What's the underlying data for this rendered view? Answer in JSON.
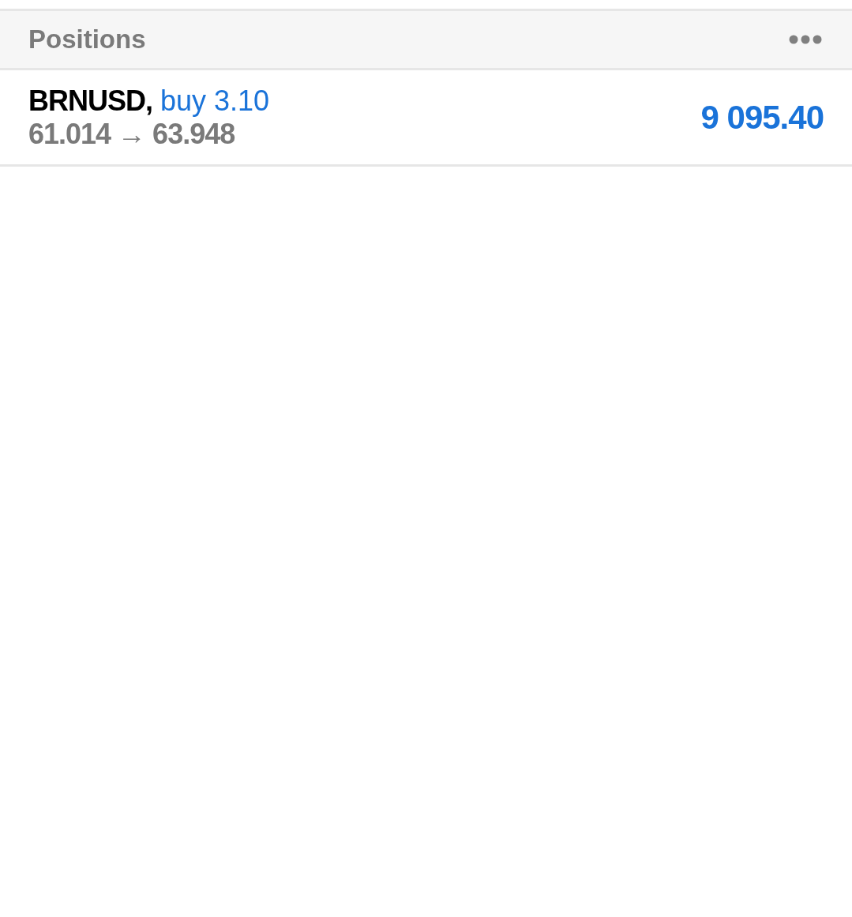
{
  "header": {
    "title": "Positions"
  },
  "positions": [
    {
      "symbol": "BRNUSD,",
      "order": "buy 3.10",
      "prices": "61.014 → 63.948",
      "profit": "9 095.40"
    }
  ]
}
